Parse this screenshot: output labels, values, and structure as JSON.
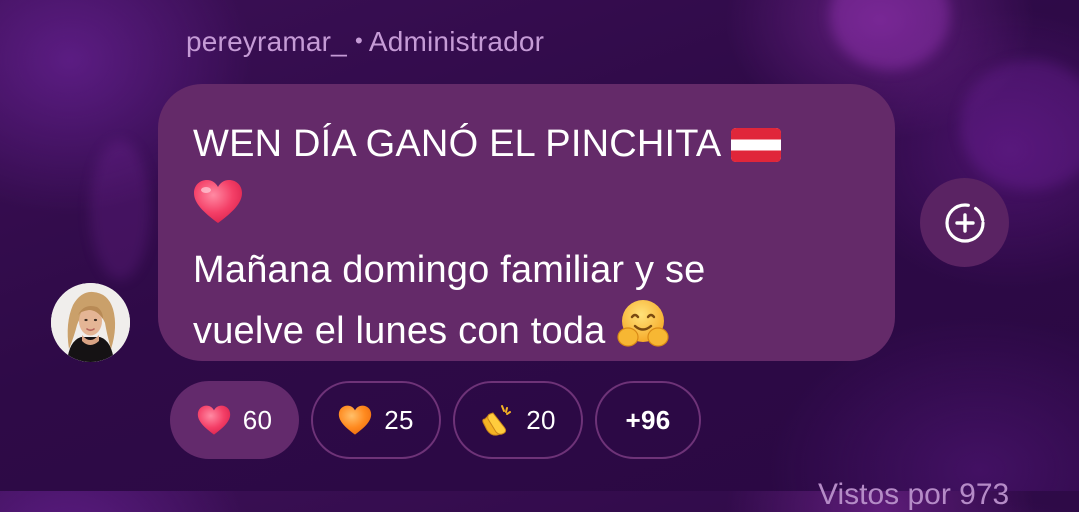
{
  "message": {
    "sender_name": "pereyramar_",
    "separator": "•",
    "sender_role": "Administrador",
    "lines": [
      "WEN DÍA GANÓ EL PINCHITA",
      "",
      "Mañana domingo familiar y se",
      "vuelve el lunes con toda"
    ],
    "emojis": [
      "austria-flag-emoji",
      "red-heart-emoji",
      "hugging-face-emoji"
    ]
  },
  "reactions": [
    {
      "emoji": "red-heart-emoji",
      "count": "60",
      "selected": true
    },
    {
      "emoji": "orange-heart-emoji",
      "count": "25",
      "selected": false
    },
    {
      "emoji": "clapping-hands-emoji",
      "count": "20",
      "selected": false
    }
  ],
  "more_reactions": "+96",
  "footer_partial": "Vistos por 973",
  "colors": {
    "bubble": "#642a69",
    "sender_text": "#c59bd6",
    "chip_selected": "#632a6c",
    "chip_border": "#6e3378"
  }
}
